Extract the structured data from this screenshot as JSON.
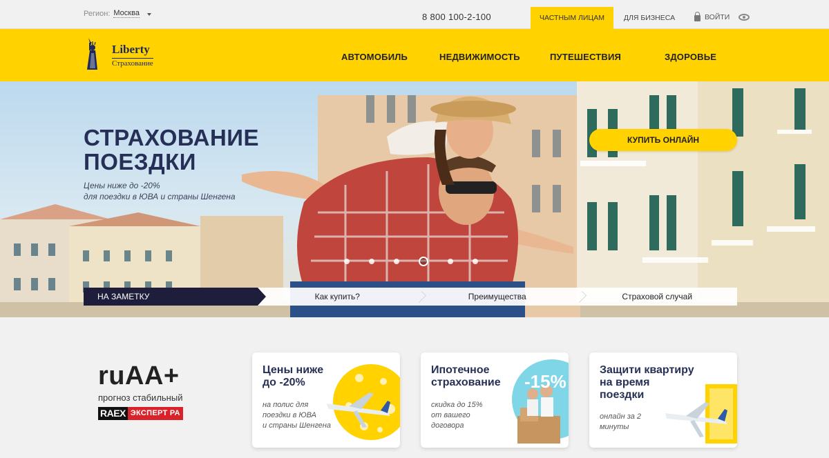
{
  "topbar": {
    "region_label": "Регион:",
    "region_value": "Москва",
    "phone": "8 800 100-2-100",
    "tab_private": "ЧАСТНЫМ ЛИЦАМ",
    "tab_business": "ДЛЯ БИЗНЕСА",
    "login": "ВОЙТИ"
  },
  "header": {
    "logo_name": "Liberty",
    "logo_sub": "Страхование",
    "nav": [
      "АВТОМОБИЛЬ",
      "НЕДВИЖИМОСТЬ",
      "ПУТЕШЕСТВИЯ",
      "ЗДОРОВЬЕ"
    ]
  },
  "hero": {
    "title_line1": "СТРАХОВАНИЕ",
    "title_line2": "ПОЕЗДКИ",
    "sub_line1": "Цены ниже до -20%",
    "sub_line2": "для поездки в ЮВА и страны Шенгена",
    "buy_button": "КУПИТЬ ОНЛАЙН",
    "slide_count": 6,
    "active_slide": 4,
    "steps": [
      "НА ЗАМЕТКУ",
      "Как купить?",
      "Преимущества",
      "Страховой случай"
    ]
  },
  "rating": {
    "value": "ruAA+",
    "sub": "прогноз стабильный",
    "badge_a": "RAEX",
    "badge_b": "ЭКСПЕРТ РА"
  },
  "cards": [
    {
      "title_line1": "Цены ниже",
      "title_line2": "до -20%",
      "sub": [
        "на полис для",
        "поездки в ЮВА",
        "и страны Шенгена"
      ]
    },
    {
      "title_line1": "Ипотечное",
      "title_line2": "страхование",
      "badge": "-15%",
      "sub": [
        "скидка до 15%",
        "от вашего",
        "договора"
      ]
    },
    {
      "title_line1": "Защити квартиру",
      "title_line2": "на время",
      "title_line3": "поездки",
      "sub": [
        "онлайн за 2",
        "минуты"
      ]
    }
  ],
  "colors": {
    "brand_yellow": "#ffd200",
    "navy": "#263056",
    "dark_step": "#1e1e3c"
  }
}
